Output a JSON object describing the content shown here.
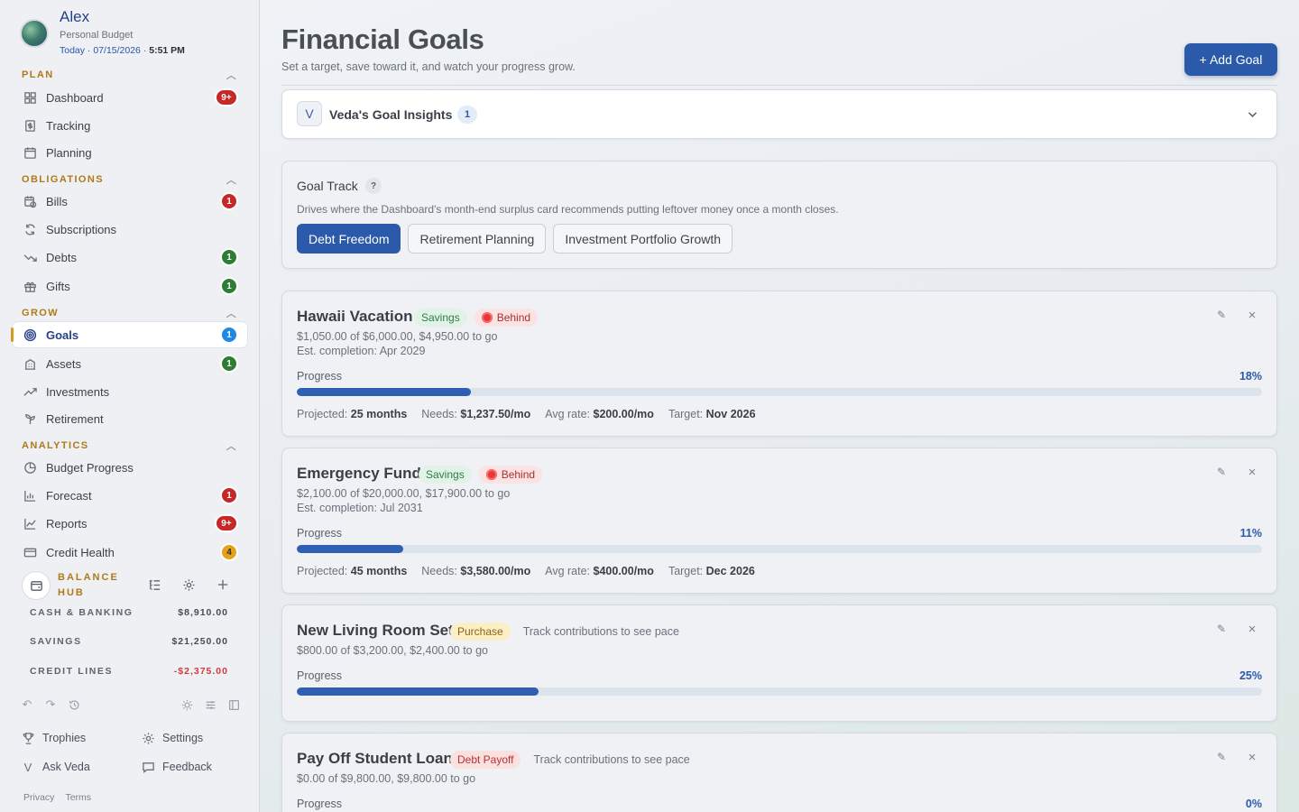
{
  "profile": {
    "name": "Alex",
    "subtitle": "Personal Budget",
    "date_prefix": "Today · 07/15/2026 · ",
    "time": "5:51 PM"
  },
  "sections": {
    "plan": "PLAN",
    "obligations": "OBLIGATIONS",
    "grow": "GROW",
    "analytics": "ANALYTICS"
  },
  "nav": {
    "dashboard": {
      "label": "Dashboard",
      "badge": "9+"
    },
    "tracking": {
      "label": "Tracking"
    },
    "planning": {
      "label": "Planning"
    },
    "bills": {
      "label": "Bills",
      "badge": "1"
    },
    "subscriptions": {
      "label": "Subscriptions"
    },
    "debts": {
      "label": "Debts",
      "badge": "1"
    },
    "gifts": {
      "label": "Gifts",
      "badge": "1"
    },
    "goals": {
      "label": "Goals",
      "badge": "1"
    },
    "assets": {
      "label": "Assets",
      "badge": "1"
    },
    "investments": {
      "label": "Investments"
    },
    "retirement": {
      "label": "Retirement"
    },
    "budget_progress": {
      "label": "Budget Progress"
    },
    "forecast": {
      "label": "Forecast",
      "badge": "1"
    },
    "reports": {
      "label": "Reports",
      "badge": "9+"
    },
    "credit_health": {
      "label": "Credit Health",
      "badge": "4"
    }
  },
  "balance_hub": {
    "title": "BALANCE HUB",
    "rows": [
      {
        "label": "CASH & BANKING",
        "amount": "$8,910.00"
      },
      {
        "label": "SAVINGS",
        "amount": "$21,250.00"
      },
      {
        "label": "CREDIT LINES",
        "amount": "-$2,375.00"
      }
    ]
  },
  "footer": {
    "trophies": "Trophies",
    "settings": "Settings",
    "ask_veda": "Ask Veda",
    "feedback": "Feedback",
    "privacy": "Privacy",
    "terms": "Terms"
  },
  "header": {
    "title": "Financial Goals",
    "subtitle": "Set a target, save toward it, and watch your progress grow.",
    "add_button": "+ Add Goal"
  },
  "insights": {
    "icon_letter": "V",
    "title": "Veda's Goal Insights",
    "count": "1"
  },
  "goal_track": {
    "title": "Goal Track",
    "help": "?",
    "description": "Drives where the Dashboard's month-end surplus card recommends putting leftover money once a month closes.",
    "options": [
      "Debt Freedom",
      "Retirement Planning",
      "Investment Portfolio Growth"
    ],
    "selected": "Debt Freedom"
  },
  "goals": [
    {
      "name": "Hawaii Vacation",
      "category": "Savings",
      "status": "Behind",
      "amount_line": "$1,050.00 of $6,000.00, $4,950.00 to go",
      "completion": "Est. completion: Apr 2029",
      "progress_label": "Progress",
      "progress": 18,
      "progress_text": "18%",
      "projected": "25 months",
      "needs": "$1,237.50/mo",
      "avg_rate": "$200.00/mo",
      "target": "Nov 2026"
    },
    {
      "name": "Emergency Fund",
      "category": "Savings",
      "status": "Behind",
      "amount_line": "$2,100.00 of $20,000.00, $17,900.00 to go",
      "completion": "Est. completion: Jul 2031",
      "progress_label": "Progress",
      "progress": 11,
      "progress_text": "11%",
      "projected": "45 months",
      "needs": "$3,580.00/mo",
      "avg_rate": "$400.00/mo",
      "target": "Dec 2026"
    },
    {
      "name": "New Living Room Set",
      "category": "Purchase",
      "pace_note": "Track contributions to see pace",
      "amount_line": "$800.00 of $3,200.00, $2,400.00 to go",
      "progress_label": "Progress",
      "progress": 25,
      "progress_text": "25%"
    },
    {
      "name": "Pay Off Student Loan",
      "category": "Debt Payoff",
      "pace_note": "Track contributions to see pace",
      "amount_line": "$0.00 of $9,800.00, $9,800.00 to go",
      "progress_label": "Progress",
      "progress": 0,
      "progress_text": "0%"
    }
  ],
  "stat_labels": {
    "projected": "Projected:",
    "needs": "Needs:",
    "avg_rate": "Avg rate:",
    "target": "Target:"
  },
  "actions": {
    "edit_icon": "✎",
    "close_icon": "×"
  },
  "colors": {
    "accent": "#2b5aaa",
    "section": "#b07a17",
    "badge_red": "#c62828",
    "badge_green": "#2e7d32",
    "badge_blue": "#1e88e5",
    "badge_amber": "#e3a21a",
    "negative": "#d23b3b"
  }
}
